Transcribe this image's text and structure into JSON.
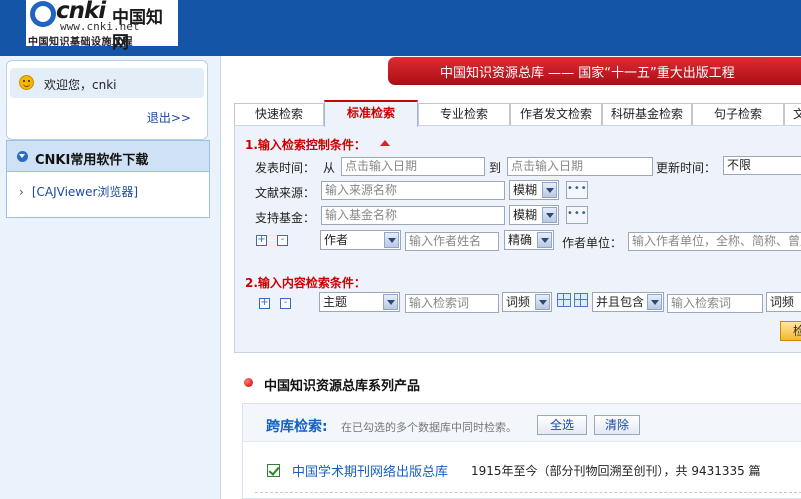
{
  "header": {
    "brand": "cnki",
    "brand_cn": "中国知网",
    "url": "www.cnki.net",
    "subtitle": "中国知识基础设施工程"
  },
  "banner": {
    "text": "中国知识资源总库 —— 国家“十一五”重大出版工程"
  },
  "sidebar": {
    "welcome": "欢迎您，cnki",
    "logout": "退出>>",
    "software_title": "CNKI常用软件下载",
    "software_items": [
      {
        "label": "[CAJViewer浏览器]"
      }
    ]
  },
  "tabs": [
    {
      "label": "快速检索",
      "active": false
    },
    {
      "label": "标准检索",
      "active": true
    },
    {
      "label": "专业检索",
      "active": false
    },
    {
      "label": "作者发文检索",
      "active": false
    },
    {
      "label": "科研基金检索",
      "active": false
    },
    {
      "label": "句子检索",
      "active": false
    },
    {
      "label": "文",
      "active": false
    }
  ],
  "control": {
    "title": "1.输入检索控制条件：",
    "pub_time_label": "发表时间：",
    "from_label": "从",
    "from_placeholder": "点击输入日期",
    "to_label": "到",
    "to_placeholder": "点击输入日期",
    "update_label": "更新时间：",
    "update_value": "不限",
    "source_label": "文献来源：",
    "source_placeholder": "输入来源名称",
    "source_match": "模糊",
    "fund_label": "支持基金：",
    "fund_placeholder": "输入基金名称",
    "fund_match": "模糊",
    "more_glyph": "•••",
    "plus_glyph": "+",
    "minus_glyph": "-",
    "author_field": "作者",
    "author_placeholder": "输入作者姓名",
    "author_match": "精确",
    "author_unit_label": "作者单位：",
    "author_unit_placeholder": "输入作者单位，全称、简称、曾用名均可"
  },
  "content": {
    "title": "2.输入内容检索条件：",
    "field": "主题",
    "keyword_placeholder": "输入检索词",
    "freq": "词频",
    "logic": "并且包含",
    "keyword2_placeholder": "输入检索词",
    "freq2": "词频",
    "search_button": "检索"
  },
  "products": {
    "section_title": "中国知识资源总库系列产品",
    "cross_label": "跨库检索:",
    "cross_hint": "在已勾选的多个数据库中同时检索。",
    "select_all": "全选",
    "clear": "清除",
    "databases": [
      {
        "name": "中国学术期刊网络出版总库",
        "desc": "1915年至今（部分刊物回溯至创刊），共 9431335 篇",
        "checked": true
      }
    ]
  },
  "colors": {
    "header_blue": "#1555a8",
    "banner_red": "#c8141d",
    "active_tab_red": "#cc0000",
    "link_blue": "#1660c0"
  }
}
